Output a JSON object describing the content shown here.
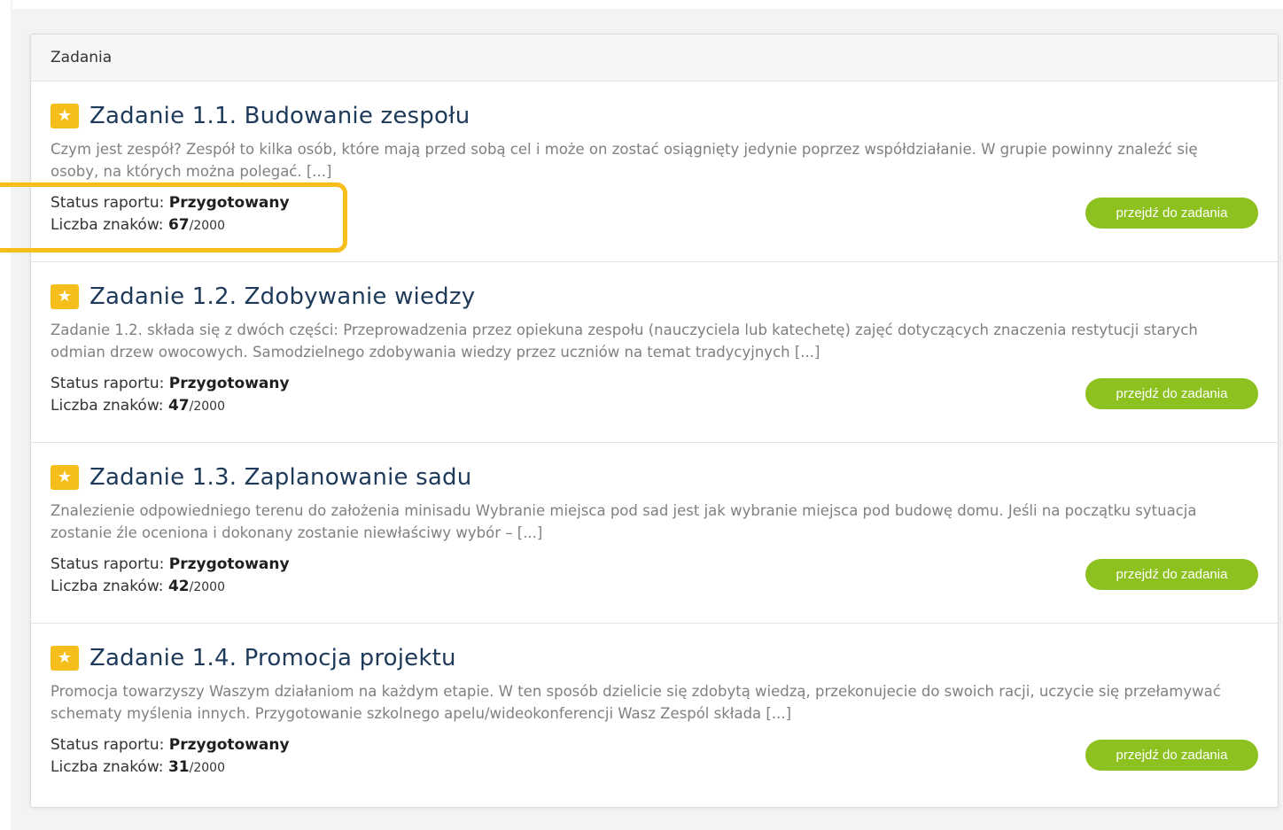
{
  "panel": {
    "title": "Zadania"
  },
  "tasks": [
    {
      "title": "Zadanie 1.1. Budowanie zespołu",
      "description": "Czym jest zespół? Zespół to kilka osób, które mają przed sobą cel i może on zostać osiągnięty jedynie poprzez współdziałanie. W grupie powinny znaleźć się osoby, na których można polegać. [...]",
      "status_label": "Status raportu:",
      "status_value": "Przygotowany",
      "chars_label": "Liczba znaków:",
      "chars_value": "67",
      "chars_max": "/2000",
      "button_label": "przejdź do zadania"
    },
    {
      "title": "Zadanie 1.2. Zdobywanie wiedzy",
      "description": "Zadanie 1.2. składa się z dwóch części: Przeprowadzenia przez opiekuna zespołu (nauczyciela lub katechetę) zajęć dotyczących znaczenia restytucji starych odmian drzew owocowych. Samodzielnego zdobywania wiedzy przez uczniów na temat tradycyjnych [...]",
      "status_label": "Status raportu:",
      "status_value": "Przygotowany",
      "chars_label": "Liczba znaków:",
      "chars_value": "47",
      "chars_max": "/2000",
      "button_label": "przejdź do zadania"
    },
    {
      "title": "Zadanie 1.3. Zaplanowanie sadu",
      "description": "Znalezienie odpowiedniego terenu do założenia minisadu Wybranie miejsca pod sad jest jak wybranie miejsca pod budowę domu. Jeśli na początku sytuacja zostanie źle oceniona i dokonany zostanie niewłaściwy wybór – [...]",
      "status_label": "Status raportu:",
      "status_value": "Przygotowany",
      "chars_label": "Liczba znaków:",
      "chars_value": "42",
      "chars_max": "/2000",
      "button_label": "przejdź do zadania"
    },
    {
      "title": "Zadanie 1.4. Promocja projektu",
      "description": "Promocja towarzyszy Waszym działaniom na każdym etapie. W ten sposób dzielicie się zdobytą wiedzą, przekonujecie do swoich racji, uczycie się przełamywać schematy myślenia innych. Przygotowanie szkolnego apelu/wideokonferencji Wasz Zespól składa [...]",
      "status_label": "Status raportu:",
      "status_value": "Przygotowany",
      "chars_label": "Liczba znaków:",
      "chars_value": "31",
      "chars_max": "/2000",
      "button_label": "przejdź do zadania"
    }
  ],
  "icons": {
    "task_icon": "star-icon"
  },
  "colors": {
    "accent_star": "#f6be1a",
    "button_green": "#8dc11f",
    "title_navy": "#1e3a5a",
    "highlight": "#f6be1a"
  }
}
